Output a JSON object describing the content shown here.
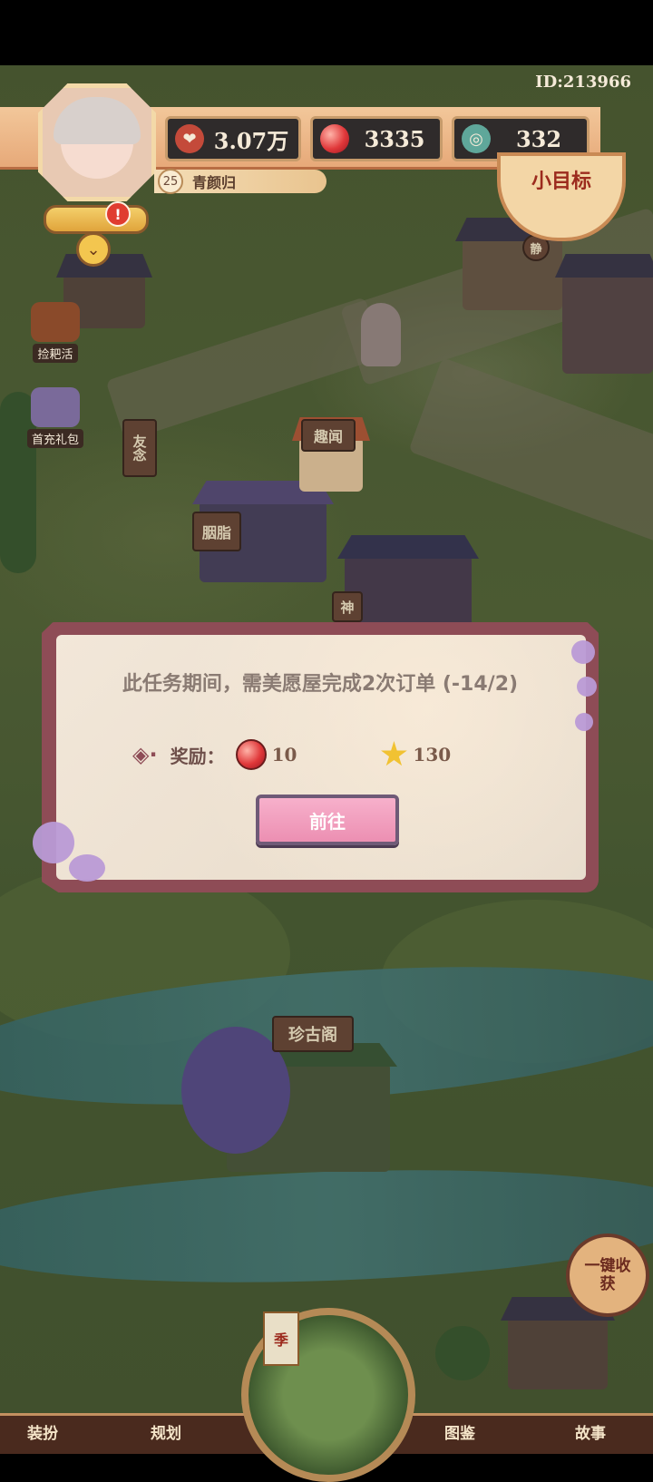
{
  "header": {
    "id_text": "ID:213966",
    "player_name": "青颜归",
    "level": "25",
    "resources": [
      {
        "icon": "heart-coin-icon",
        "value": "3.07万"
      },
      {
        "icon": "red-gem-icon",
        "value": "3335"
      },
      {
        "icon": "jade-coin-icon",
        "value": "332"
      }
    ],
    "alert": "!",
    "goal_button": "小目标"
  },
  "side_buttons": {
    "pick_work": "捡耙活",
    "first_recharge": "首充礼包"
  },
  "map_signs": {
    "rouge": "胭脂",
    "fun_news": "趣闻",
    "antique_pavilion": "珍古阁",
    "friends": "友念",
    "god": "神",
    "static": "静"
  },
  "modal": {
    "task_text": "此任务期间，需美愿屋完成2次订单 (-14/2)",
    "reward_label": "奖励：",
    "rewards": [
      {
        "icon": "red-gem-icon",
        "amount": "10"
      },
      {
        "icon": "star-icon",
        "amount": "130"
      }
    ],
    "go_button": "前往"
  },
  "bottom_nav": {
    "items": [
      "装扮",
      "规划",
      "图鉴",
      "故事"
    ],
    "season": "季",
    "collect_all": "一键收获"
  },
  "colors": {
    "modal_frame": "#8e4c56",
    "go_button": "#ec8fb2",
    "grass": "#56673a"
  }
}
